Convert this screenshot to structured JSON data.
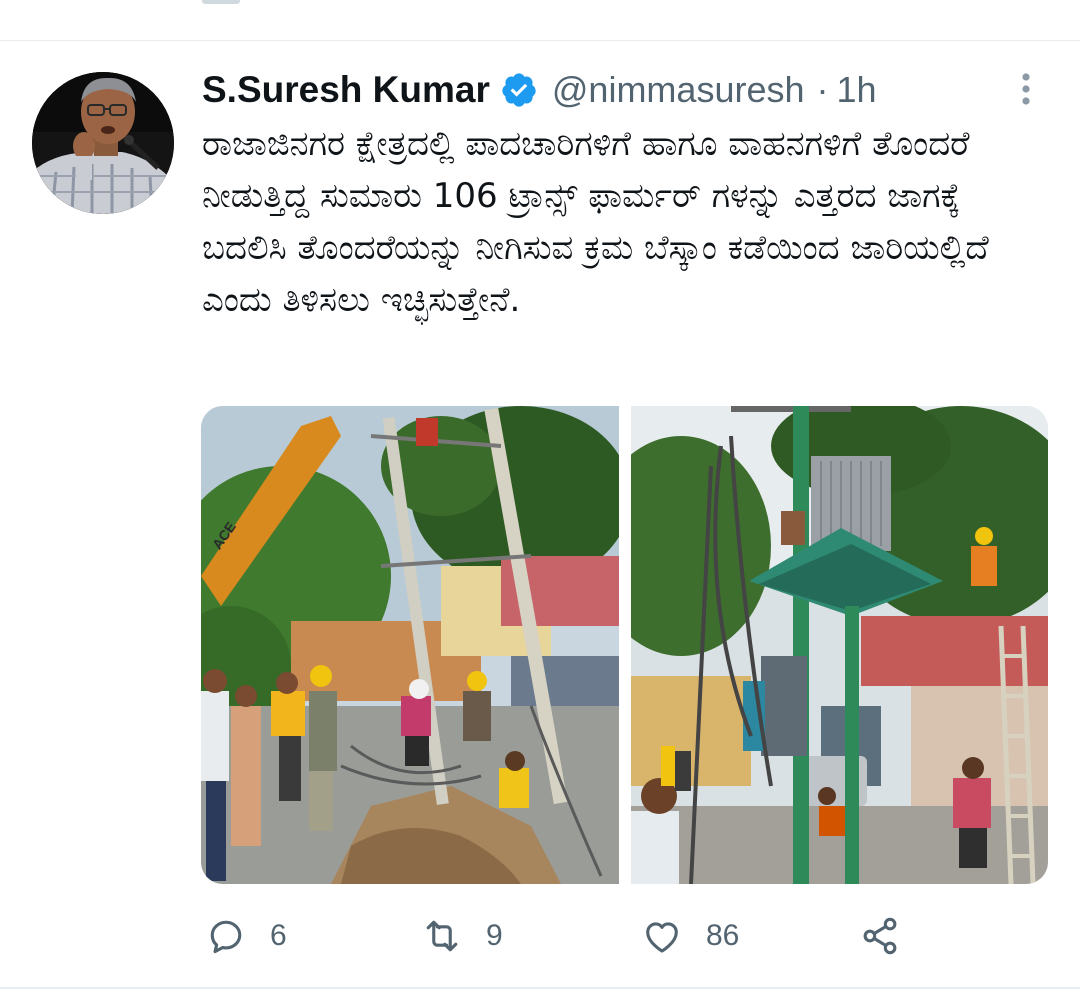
{
  "tweet": {
    "author": {
      "display_name": "S.Suresh Kumar",
      "verified": true,
      "handle": "@nimmasuresh"
    },
    "separator": "·",
    "time": "1h",
    "text": "ರಾಜಾಜಿನಗರ ಕ್ಷೇತ್ರದಲ್ಲಿ ಪಾದಚಾರಿಗಳಿಗೆ ಹಾಗೂ ವಾಹನಗಳಿಗೆ ತೊಂದರೆ ನೀಡುತ್ತಿದ್ದ ಸುಮಾರು 106 ಟ್ರಾನ್ಸ್ ಫಾರ್ಮರ್ ಗಳನ್ನು ಎತ್ತರದ ಜಾಗಕ್ಕೆ ಬದಲಿಸಿ ತೊಂದರೆಯನ್ನು ನೀಗಿಸುವ ಕ್ರಮ ಬೆಸ್ಕಾಂ ಕಡೆಯಿಂದ ಜಾರಿಯಲ್ಲಿದೆ ಎಂದು ತಿಳಿಸಲು ಇಚ್ಛಿಸುತ್ತೇನೆ.",
    "media": [
      {
        "crane_text": "ACE"
      },
      {}
    ],
    "actions": {
      "replies": "6",
      "retweets": "9",
      "likes": "86"
    }
  },
  "colors": {
    "verified_blue": "#1d9bf0",
    "muted": "#536471",
    "text": "#0f1419"
  },
  "icons": [
    "verified-badge-icon",
    "more-options-icon",
    "reply-icon",
    "retweet-icon",
    "like-icon",
    "share-icon"
  ]
}
